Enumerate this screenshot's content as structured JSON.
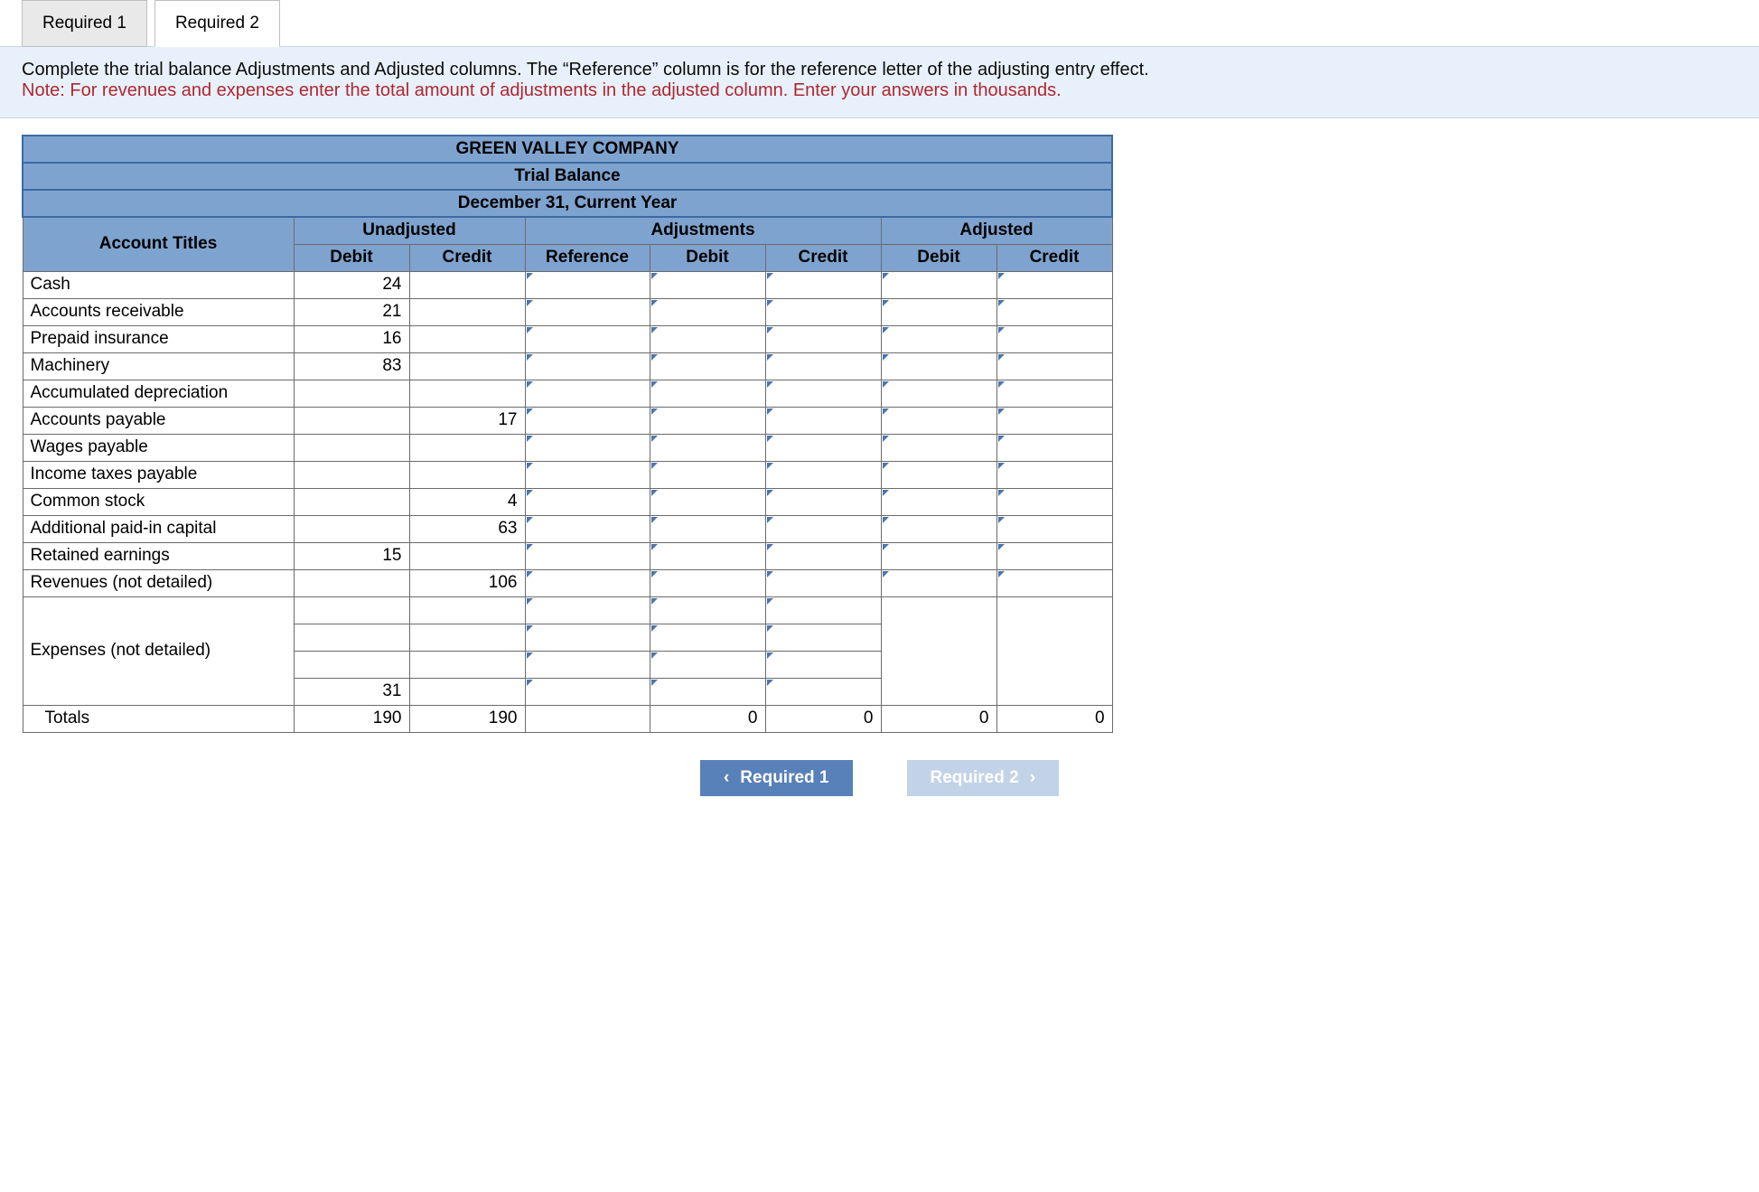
{
  "tabs": {
    "t1": "Required 1",
    "t2": "Required 2"
  },
  "instructions": {
    "main": "Complete the trial balance Adjustments and Adjusted columns. The “Reference” column is for the reference letter of the adjusting entry effect.",
    "note": "Note: For revenues and expenses enter the total amount of adjustments in the adjusted column. Enter your answers in thousands."
  },
  "header": {
    "company": "GREEN VALLEY COMPANY",
    "title": "Trial Balance",
    "date": "December 31, Current Year"
  },
  "columns": {
    "acct": "Account Titles",
    "unadjusted": "Unadjusted",
    "adjustments": "Adjustments",
    "adjusted": "Adjusted",
    "debit": "Debit",
    "credit": "Credit",
    "reference": "Reference"
  },
  "rows": [
    {
      "title": "Cash",
      "udeb": "24",
      "ucred": ""
    },
    {
      "title": "Accounts receivable",
      "udeb": "21",
      "ucred": ""
    },
    {
      "title": "Prepaid insurance",
      "udeb": "16",
      "ucred": ""
    },
    {
      "title": "Machinery",
      "udeb": "83",
      "ucred": ""
    },
    {
      "title": "Accumulated depreciation",
      "udeb": "",
      "ucred": ""
    },
    {
      "title": "Accounts payable",
      "udeb": "",
      "ucred": "17"
    },
    {
      "title": "Wages payable",
      "udeb": "",
      "ucred": ""
    },
    {
      "title": "Income taxes payable",
      "udeb": "",
      "ucred": ""
    },
    {
      "title": "Common stock",
      "udeb": "",
      "ucred": "4"
    },
    {
      "title": "Additional paid-in capital",
      "udeb": "",
      "ucred": "63"
    },
    {
      "title": "Retained earnings",
      "udeb": "15",
      "ucred": ""
    },
    {
      "title": "Revenues (not detailed)",
      "udeb": "",
      "ucred": "106"
    }
  ],
  "expenses": {
    "title": "Expenses (not detailed)",
    "last_udeb": "31"
  },
  "totals": {
    "label": "Totals",
    "udeb": "190",
    "ucred": "190",
    "adjdeb": "0",
    "adjcred": "0",
    "adeb": "0",
    "acred": "0"
  },
  "nav": {
    "prev": "Required 1",
    "next": "Required 2"
  }
}
